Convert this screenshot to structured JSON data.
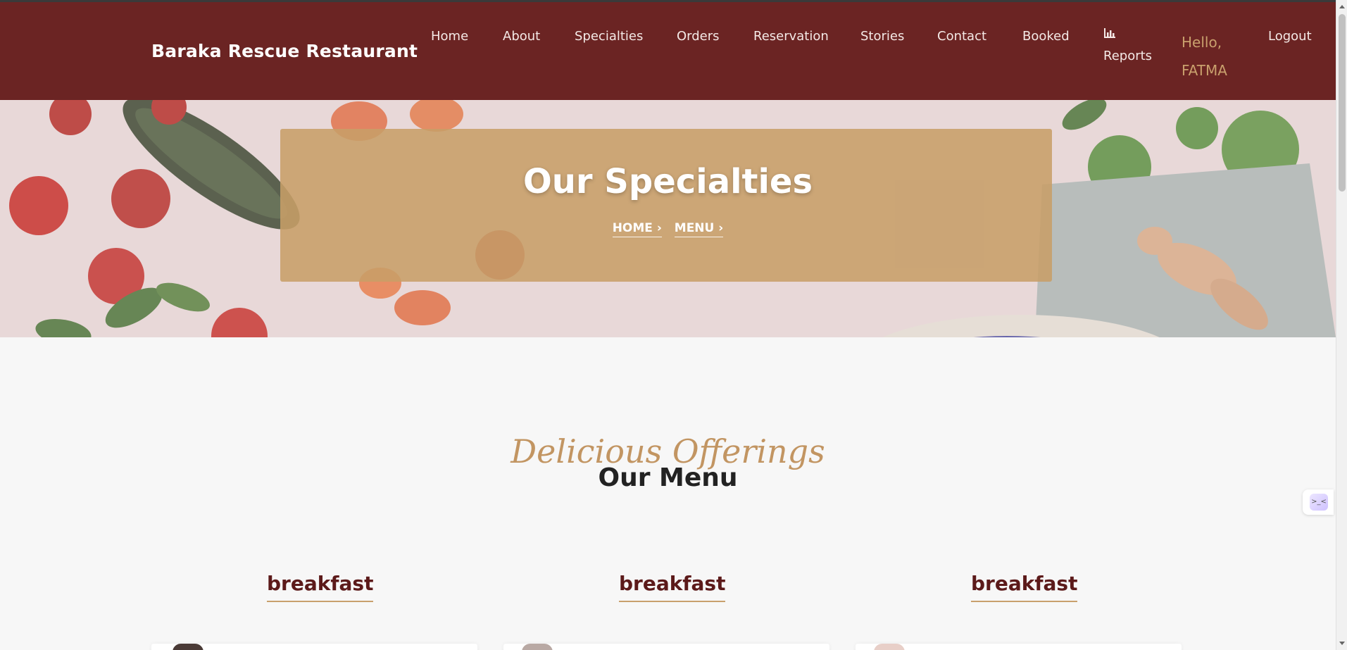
{
  "header": {
    "brand": "Baraka Rescue Restaurant",
    "nav": [
      "Home",
      "About",
      "Specialties",
      "Orders",
      "Reservation",
      "Stories",
      "Contact",
      "Booked"
    ],
    "reports_label": "Reports",
    "reports_icon": "bar-chart-icon",
    "hello_line1": "Hello,",
    "hello_line2": "FATMA",
    "logout_label": "Logout"
  },
  "hero": {
    "title": "Our Specialties",
    "breadcrumbs": [
      "HOME",
      "MENU"
    ]
  },
  "menu_section": {
    "script_title": "Delicious Offerings",
    "title": "Our Menu",
    "categories": [
      "breakfast",
      "breakfast",
      "breakfast"
    ]
  },
  "colors": {
    "header_bg": "#6b2423",
    "accent_gold": "#c9a06d",
    "category_text": "#5c1a1a"
  }
}
